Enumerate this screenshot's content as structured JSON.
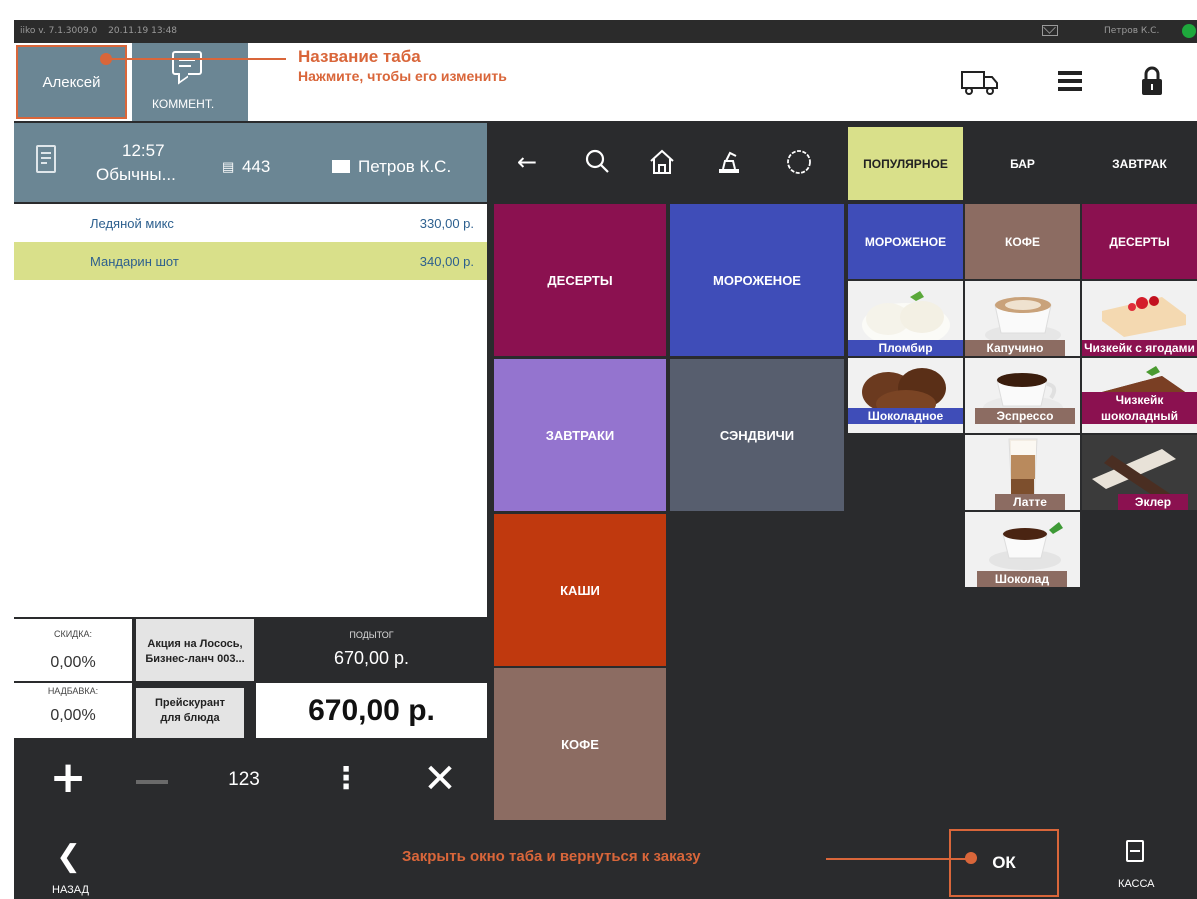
{
  "status": {
    "version": "iiko  v. 7.1.3009.0",
    "datetime": "20.11.19  13:48",
    "user": "Петров К.С."
  },
  "top": {
    "tab_name": "Алексей",
    "comment_label": "КОММЕНТ."
  },
  "callouts": {
    "tab_title": "Название таба",
    "tab_hint": "Нажмите, чтобы его изменить",
    "close_hint": "Закрыть окно таба и вернуться к заказу"
  },
  "order": {
    "time": "12:57",
    "type": "Обычны...",
    "number": "443",
    "waiter": "Петров К.С."
  },
  "items": [
    {
      "name": "Ледяной микс",
      "price": "330,00 р."
    },
    {
      "name": "Мандарин шот",
      "price": "340,00 р."
    }
  ],
  "totals": {
    "discount_label": "СКИДКА:",
    "discount_value": "0,00%",
    "surcharge_label": "НАДБАВКА:",
    "surcharge_value": "0,00%",
    "promo_line1": "Акция на Лосось,",
    "promo_line2": "Бизнес-ланч 003...",
    "price_line1": "Прейскурант",
    "price_line2": "для блюда",
    "subtotal_label": "ПОДЫТОГ",
    "subtotal_value": "670,00 р.",
    "total": "670,00 р."
  },
  "actions": {
    "qty": "123"
  },
  "categories": [
    "ДЕСЕРТЫ",
    "МОРОЖЕНОЕ",
    "ЗАВТРАКИ",
    "СЭНДВИЧИ",
    "КАШИ",
    "КОФЕ"
  ],
  "right_tabs": [
    "ПОПУЛЯРНОЕ",
    "БАР",
    "ЗАВТРАК"
  ],
  "subcats": [
    "МОРОЖЕНОЕ",
    "КОФЕ",
    "ДЕСЕРТЫ"
  ],
  "products": {
    "plombir": "Пломбир",
    "kapuchino": "Капучино",
    "cheesecake_berries": "Чизкейк с ягодами",
    "shokoladnoe": "Шоколадное",
    "espresso": "Эспрессо",
    "cheesecake_choc": "Чизкейк шоколадный",
    "latte": "Латте",
    "ekler": "Эклер",
    "shokolad": "Шоколад"
  },
  "bottom": {
    "back_label": "НАЗАД",
    "ok_label": "ОК",
    "kassa_label": "КАССА"
  },
  "colors": {
    "desserts": "#8b1150",
    "icecream": "#3f4db8",
    "breakfast": "#9474cf",
    "sandwich": "#575e6e",
    "porridge": "#c0390e",
    "coffee": "#8c6c62",
    "accent": "#d9663a",
    "selected": "#d9e08a",
    "header": "#6b8694"
  }
}
